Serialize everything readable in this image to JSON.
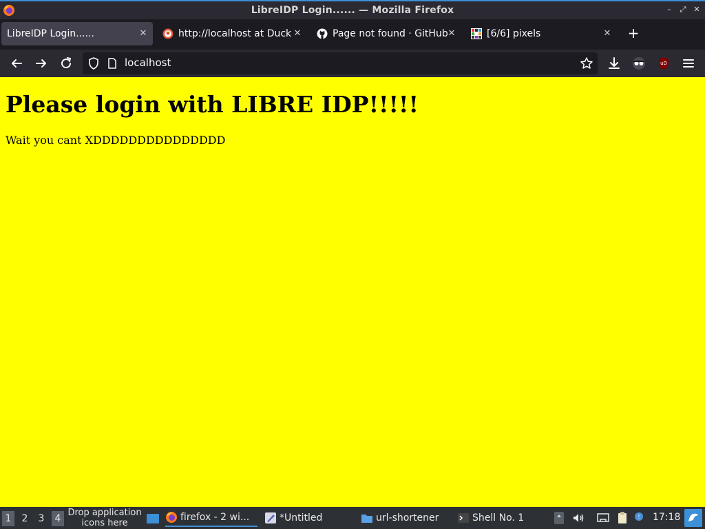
{
  "window": {
    "title": "LibreIDP Login...... — Mozilla Firefox"
  },
  "tabs": [
    {
      "label": "LibreIDP Login......",
      "icon": "none",
      "active": true
    },
    {
      "label": "http://localhost at Duck",
      "icon": "duckduckgo-icon",
      "active": false
    },
    {
      "label": "Page not found · GitHub",
      "icon": "github-icon",
      "active": false
    },
    {
      "label": "[6/6] pixels",
      "icon": "pixels-icon",
      "active": false
    }
  ],
  "navbar": {
    "url": "localhost"
  },
  "page": {
    "heading": "Please login with LIBRE IDP!!!!!",
    "text": "Wait you cant XDDDDDDDDDDDDDDD",
    "background": "#ffff00"
  },
  "taskbar": {
    "workspaces": [
      "1",
      "2",
      "3",
      "4"
    ],
    "drop_hint": "Drop application icons here",
    "tasks": [
      {
        "label": "firefox - 2 wi...",
        "icon": "firefox-icon"
      },
      {
        "label": "*Untitled",
        "icon": "text-editor-icon"
      },
      {
        "label": "url-shortener",
        "icon": "folder-icon"
      },
      {
        "label": "Shell No. 1",
        "icon": "terminal-icon"
      }
    ],
    "clock": "17:18"
  },
  "colors": {
    "accent": "#3d8fd6",
    "chrome_dark": "#1c1b22",
    "chrome": "#2b2a33"
  }
}
